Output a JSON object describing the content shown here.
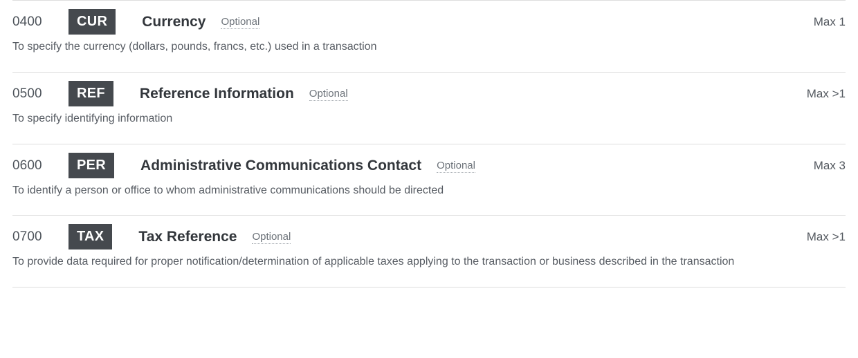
{
  "segments": [
    {
      "code": "0400",
      "tag": "CUR",
      "title": "Currency",
      "requirement": "Optional",
      "max": "Max 1",
      "description": "To specify the currency (dollars, pounds, francs, etc.) used in a transaction"
    },
    {
      "code": "0500",
      "tag": "REF",
      "title": "Reference Information",
      "requirement": "Optional",
      "max": "Max >1",
      "description": "To specify identifying information"
    },
    {
      "code": "0600",
      "tag": "PER",
      "title": "Administrative Communications Contact",
      "requirement": "Optional",
      "max": "Max 3",
      "description": "To identify a person or office to whom administrative communications should be directed"
    },
    {
      "code": "0700",
      "tag": "TAX",
      "title": "Tax Reference",
      "requirement": "Optional",
      "max": "Max >1",
      "description": "To provide data required for proper notification/determination of applicable taxes applying to the transaction or business described in the transaction"
    }
  ],
  "colors": {
    "badge_background": "#45494e",
    "badge_text": "#ffffff",
    "title_text": "#33373c",
    "code_text": "#4f555c",
    "description_text": "#575c63",
    "divider": "#dddddd",
    "requirement_text": "#6d737a"
  }
}
